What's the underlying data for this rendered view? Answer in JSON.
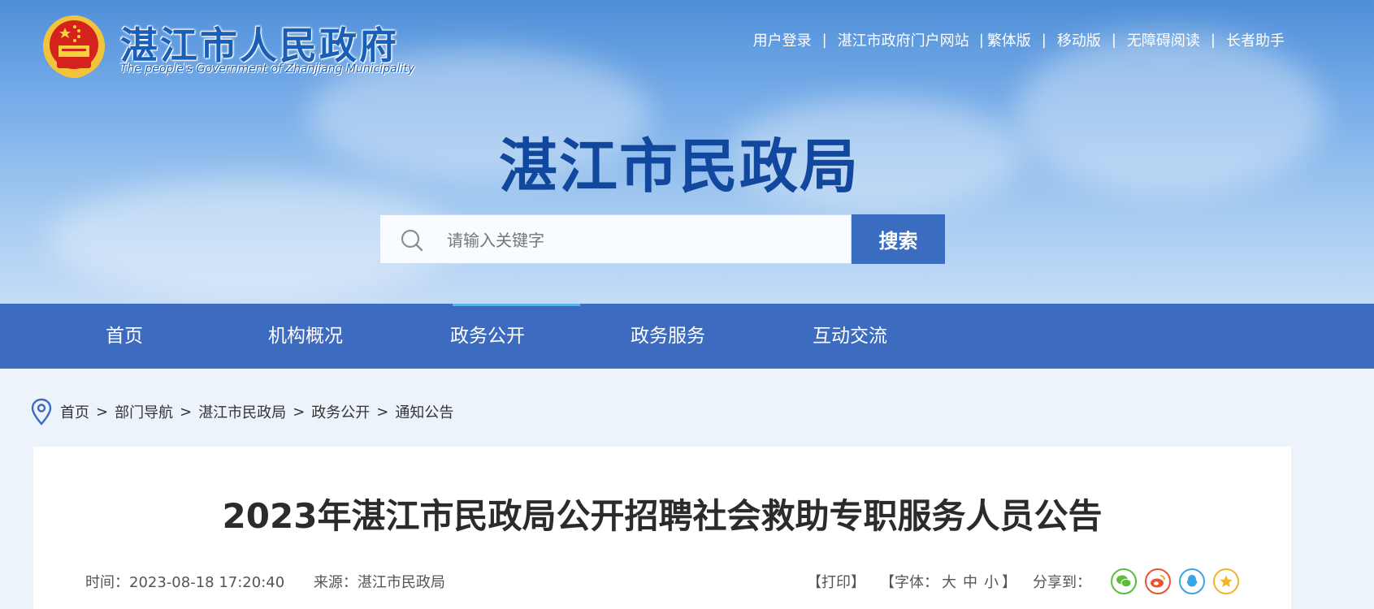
{
  "header": {
    "gov_title": "湛江市人民政府",
    "gov_subtitle": "The people's Government of Zhanjiang Municipality",
    "dept_title": "湛江市民政局",
    "top_links": [
      "用户登录",
      "湛江市政府门户网站",
      "繁体版",
      "移动版",
      "无障碍阅读",
      "长者助手"
    ],
    "separators": [
      "|",
      "|",
      "|",
      "|",
      "|"
    ]
  },
  "search": {
    "placeholder": "请输入关键字",
    "button_label": "搜索"
  },
  "nav": {
    "items": [
      "首页",
      "机构概况",
      "政务公开",
      "政务服务",
      "互动交流"
    ],
    "active": "政务公开"
  },
  "breadcrumb": {
    "items": [
      "首页",
      "部门导航",
      "湛江市民政局",
      "政务公开",
      "通知公告"
    ],
    "separator": ">"
  },
  "article": {
    "title": "2023年湛江市民政局公开招聘社会救助专职服务人员公告",
    "time": "时间：2023-08-18 17:20:40",
    "source": "来源：湛江市民政局",
    "print_label": "【打印】",
    "font_label": "【字体：",
    "font_large": "大",
    "font_medium": "中",
    "font_small": "小",
    "font_close": "】",
    "share_label": "分享到："
  },
  "icons": [
    "emblem-icon",
    "search-icon",
    "location-pin-icon",
    "wechat-icon",
    "weibo-icon",
    "qq-icon",
    "favorite-star-icon"
  ],
  "colors": {
    "nav_bg": "#3c6bc0",
    "search_button": "#3a6cbf",
    "dept_title": "#11479c",
    "wechat": "#5bbd3b",
    "weibo": "#e8542e",
    "qq": "#3ba4e6",
    "favorite": "#f2b527"
  }
}
